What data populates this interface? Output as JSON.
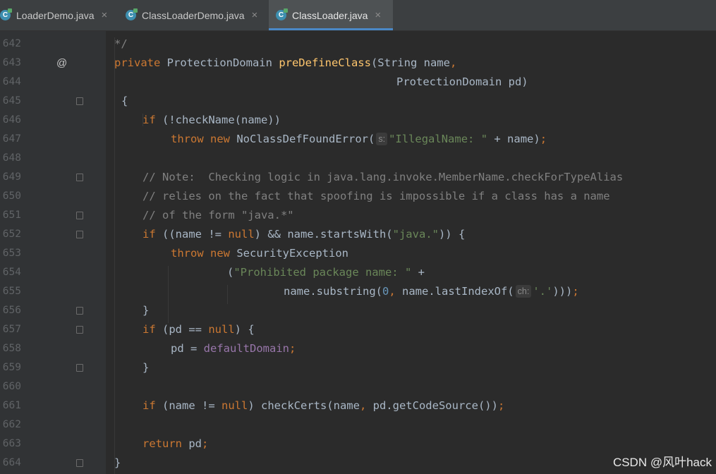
{
  "tabs": [
    {
      "icon": "java-class-icon",
      "label": "LoaderDemo.java",
      "active": false
    },
    {
      "icon": "java-class-icon",
      "label": "ClassLoaderDemo.java",
      "active": false
    },
    {
      "icon": "java-class-icon",
      "label": "ClassLoader.java",
      "active": true
    }
  ],
  "tab_close_glyph": "×",
  "icon_glyph": "C",
  "override_marker": "@",
  "lines": [
    {
      "n": "642",
      "t1": "*/"
    },
    {
      "n": "643",
      "t1": "private",
      "t2": " ProtectionDomain ",
      "t3": "preDefineClass",
      "t4": "(String name",
      "t5": ","
    },
    {
      "n": "644",
      "t1": "ProtectionDomain pd)"
    },
    {
      "n": "645",
      "t1": "{"
    },
    {
      "n": "646",
      "t1": "if",
      "t2": " (!checkName(name))"
    },
    {
      "n": "647",
      "t1": "throw",
      "t2": " ",
      "t3": "new",
      "t4": " NoClassDefFoundError(",
      "hint": "s:",
      "t5": "\"IllegalName: \"",
      "t6": " + name)",
      "t7": ";"
    },
    {
      "n": "648"
    },
    {
      "n": "649",
      "t1": "// Note:  Checking logic in java.lang.invoke.MemberName.checkForTypeAlias"
    },
    {
      "n": "650",
      "t1": "// relies on the fact that spoofing is impossible if a class has a name"
    },
    {
      "n": "651",
      "t1": "// of the form \"java.*\""
    },
    {
      "n": "652",
      "t1": "if",
      "t2": " ((name != ",
      "t3": "null",
      "t4": ") && name.startsWith(",
      "t5": "\"java.\"",
      "t6": ")) {"
    },
    {
      "n": "653",
      "t1": "throw",
      "t2": " ",
      "t3": "new",
      "t4": " SecurityException"
    },
    {
      "n": "654",
      "t1": "(",
      "t2": "\"Prohibited package name: \"",
      "t3": " +"
    },
    {
      "n": "655",
      "t1": "name.substring(",
      "t2": "0",
      "t3": ", ",
      "t4": "name.lastIndexOf(",
      "hint": "ch:",
      "t5": "'.'",
      "t6": ")))",
      "t7": ";"
    },
    {
      "n": "656",
      "t1": "}"
    },
    {
      "n": "657",
      "t1": "if",
      "t2": " (pd == ",
      "t3": "null",
      "t4": ") {"
    },
    {
      "n": "658",
      "t1": "pd = ",
      "t2": "defaultDomain",
      "t3": ";"
    },
    {
      "n": "659",
      "t1": "}"
    },
    {
      "n": "660"
    },
    {
      "n": "661",
      "t1": "if",
      "t2": " (name != ",
      "t3": "null",
      "t4": ") checkCerts(name",
      "t5": ", ",
      "t6": "pd.getCodeSource())",
      "t7": ";"
    },
    {
      "n": "662"
    },
    {
      "n": "663",
      "t1": "return",
      "t2": " pd",
      "t3": ";"
    },
    {
      "n": "664",
      "t1": "}"
    }
  ],
  "watermark": "CSDN @风叶hack",
  "colors": {
    "editor_bg": "#2b2b2b",
    "keyword": "#cc7832",
    "function_decl": "#ffc66d",
    "string": "#6a8759",
    "number": "#6897bb",
    "comment": "#808080",
    "field": "#9876aa",
    "active_tab_underline": "#4a88c7"
  }
}
